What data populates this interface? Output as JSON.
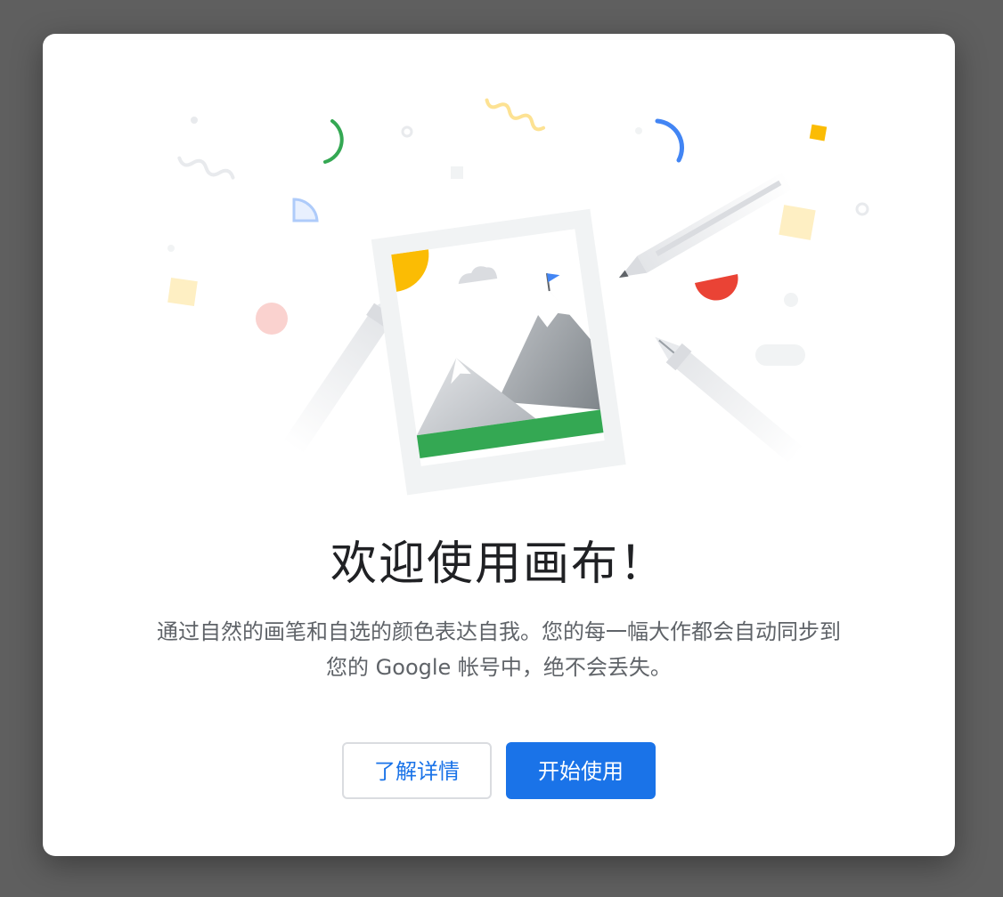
{
  "dialog": {
    "title": "欢迎使用画布！",
    "description_line1": "通过自然的画笔和自选的颜色表达自我。您的每一幅大作都会自动同步到",
    "description_line2": "您的 Google 帐号中，绝不会丢失。",
    "secondary_button": "了解详情",
    "primary_button": "开始使用"
  },
  "colors": {
    "overlay": "#5f5f5f",
    "primary": "#1a73e8",
    "title_text": "#202124",
    "body_text": "#5f6368",
    "green": "#34a853",
    "yellow": "#fbbc04",
    "red": "#ea4335",
    "blue": "#4285f4"
  },
  "illustration": {
    "icons": [
      "canvas-picture-icon",
      "pencil-icon",
      "marker-icon",
      "fountain-pen-icon",
      "confetti-icon"
    ]
  }
}
